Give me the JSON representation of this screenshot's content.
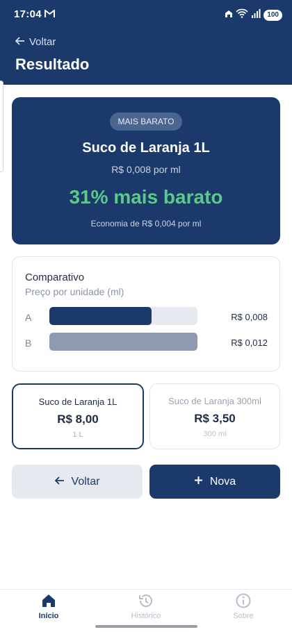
{
  "status_bar": {
    "time": "17:04",
    "battery": "100",
    "icons": [
      "gmail-icon",
      "home-signal-icon",
      "wifi-icon",
      "cell-signal-icon",
      "battery-icon"
    ]
  },
  "header": {
    "back_label": "Voltar",
    "title": "Resultado"
  },
  "hero": {
    "badge": "MAIS BARATO",
    "product": "Suco de Laranja 1L",
    "unit_price": "R$ 0,008 por ml",
    "percent_text": "31% mais barato",
    "savings": "Economia de R$ 0,004 por ml"
  },
  "comparison": {
    "title": "Comparativo",
    "subtitle": "Preço por unidade (ml)",
    "rows": [
      {
        "label": "A",
        "value": "R$ 0,008",
        "fraction": 0.69,
        "color": "#1b3a6b"
      },
      {
        "label": "B",
        "value": "R$ 0,012",
        "fraction": 1.0,
        "color": "#8e9ab0"
      }
    ]
  },
  "products": [
    {
      "name": "Suco de Laranja 1L",
      "price": "R$ 8,00",
      "size": "1 L",
      "selected": true
    },
    {
      "name": "Suco de Laranja 300ml",
      "price": "R$ 3,50",
      "size": "300 ml",
      "selected": false
    }
  ],
  "actions": {
    "back_label": "Voltar",
    "new_label": "Nova"
  },
  "bottom_nav": [
    {
      "label": "Início",
      "icon": "home-icon",
      "active": true
    },
    {
      "label": "Histórico",
      "icon": "history-icon",
      "active": false
    },
    {
      "label": "Sobre",
      "icon": "info-icon",
      "active": false
    }
  ],
  "colors": {
    "primary": "#1b3a6b",
    "accent_green": "#5cc98a",
    "muted": "#8e9ab0"
  }
}
